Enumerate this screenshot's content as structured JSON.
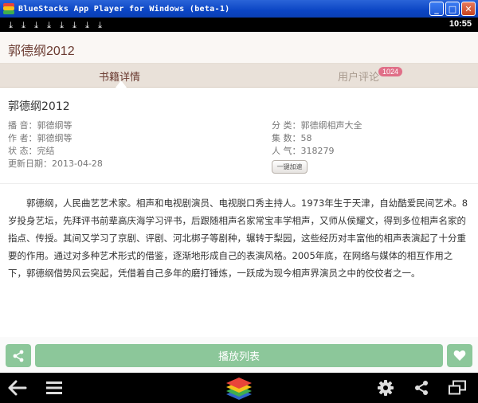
{
  "window": {
    "title": "BlueStacks App Player for Windows (beta-1)",
    "minimize_glyph": "_",
    "maximize_glyph": "□",
    "close_glyph": "✕"
  },
  "statusbar": {
    "time": "10:55",
    "download_icon_count": 8
  },
  "header": {
    "title": "郭德纲2012"
  },
  "tabs": [
    {
      "label": "书籍详情",
      "active": true
    },
    {
      "label": "用户评论",
      "badge": "1024",
      "active": false
    }
  ],
  "details": {
    "title": "郭德纲2012",
    "left": [
      {
        "label": "播  音：",
        "value": "郭德纲等"
      },
      {
        "label": "作  者：",
        "value": "郭德纲等"
      },
      {
        "label": "状  态：",
        "value": "完结"
      },
      {
        "label": "更新日期：",
        "value": "2013-04-28"
      }
    ],
    "right": [
      {
        "label": "分  类：",
        "value": "郭德纲相声大全"
      },
      {
        "label": "集  数：",
        "value": "58"
      },
      {
        "label": "人  气：",
        "value": "318279"
      }
    ],
    "boost_label": "一键加速",
    "description": "郭德纲，人民曲艺艺术家。相声和电视剧演员、电视脱口秀主持人。1973年生于天津，自幼酷爱民间艺术。8岁投身艺坛，先拜评书前辈高庆海学习评书，后跟随相声名家常宝丰学相声，又师从侯耀文，得到多位相声名家的指点、传授。其间又学习了京剧、评剧、河北梆子等剧种，辗转于梨园，这些经历对丰富他的相声表演起了十分重要的作用。通过对多种艺术形式的借鉴，逐渐地形成自己的表演风格。2005年底，在网络与媒体的相互作用之下，郭德纲借势风云突起，凭借着自己多年的磨打锤炼，一跃成为现今相声界演员之中的佼佼者之一。"
  },
  "actions": {
    "play_label": "播放列表"
  },
  "colors": {
    "titlebar": "#0b45c4",
    "accent_green": "#8cc79a",
    "title_brown": "#6a3a30",
    "badge_pink": "#e06f88"
  },
  "icons": {
    "share": "share-icon",
    "heart": "heart-icon",
    "back": "back-arrow-icon",
    "menu": "menu-icon",
    "bluestacks": "bluestacks-logo-icon",
    "settings": "gear-icon",
    "nav_share": "share-icon",
    "windows": "multi-window-icon"
  }
}
